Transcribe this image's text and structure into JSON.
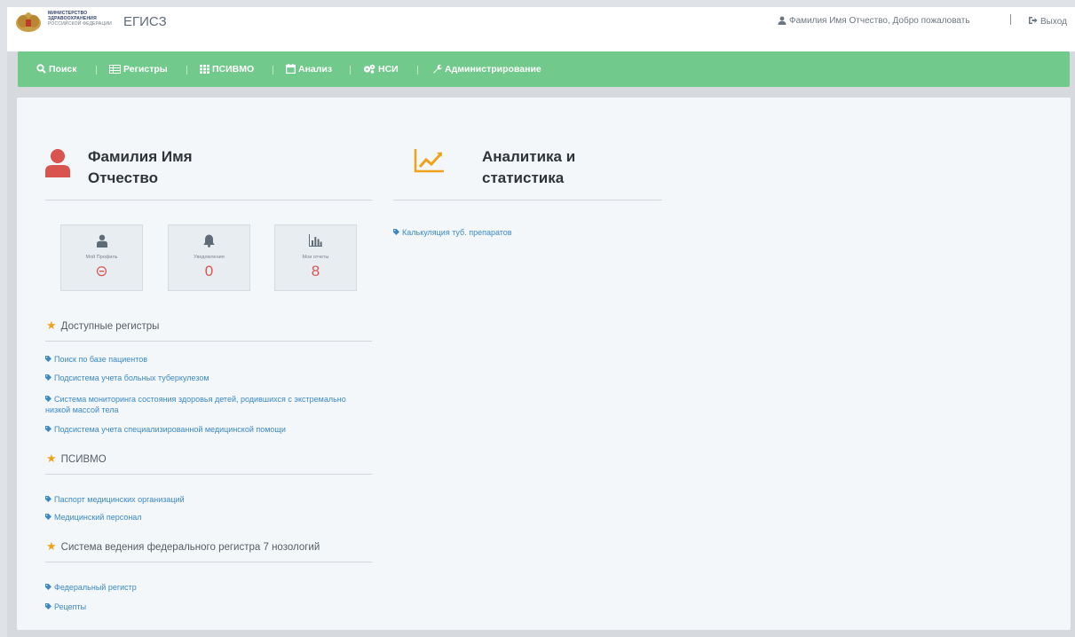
{
  "header": {
    "ministry_lines": [
      "МИНИСТЕРСТВО",
      "ЗДРАВООХРАНЕНИЯ",
      "РОССИЙСКОЙ ФЕДЕРАЦИИ"
    ],
    "app_title": "ЕГИСЗ",
    "user_greeting": "Фамилия Имя Отчество, Добро пожаловать",
    "logout_label": "Выход"
  },
  "nav": {
    "items": [
      {
        "label": "Поиск",
        "icon": "search-icon"
      },
      {
        "label": "Регистры",
        "icon": "list-icon"
      },
      {
        "label": "ПСИВМО",
        "icon": "grid-icon"
      },
      {
        "label": "Анализ",
        "icon": "calendar-icon"
      },
      {
        "label": "НСИ",
        "icon": "cogs-icon"
      },
      {
        "label": "Администрирование",
        "icon": "wrench-icon"
      }
    ]
  },
  "profile": {
    "name_line1": "Фамилия Имя",
    "name_line2": "Отчество",
    "cards": [
      {
        "label": "Мой Профиль",
        "value": "⊝",
        "icon": "user-icon"
      },
      {
        "label": "Уведомления",
        "value": "0",
        "icon": "bell-icon"
      },
      {
        "label": "Мои отчеты",
        "value": "8",
        "icon": "bar-chart-icon"
      }
    ]
  },
  "sections": [
    {
      "title": "Доступные регистры",
      "links": [
        "Поиск по базе пациентов",
        "Подсистема учета больных туберкулезом",
        "Система мониторинга состояния здоровья детей, родившихся с экстремально низкой массой тела",
        "Подсистема учета специализированной медицинской помощи"
      ]
    },
    {
      "title": "ПСИВМО",
      "links": [
        "Паспорт медицинских организаций",
        "Медицинский персонал"
      ]
    },
    {
      "title": "Система ведения федерального регистра 7 нозологий",
      "links": [
        "Федеральный регистр",
        "Рецепты"
      ]
    }
  ],
  "analytics": {
    "title_line1": "Аналитика и",
    "title_line2": "статистика",
    "links": [
      "Калькуляция туб. препаратов"
    ]
  },
  "colors": {
    "nav_bg": "#72c98c",
    "accent_red": "#d9534f",
    "accent_orange": "#f0a21b",
    "link": "#3a88c4"
  }
}
